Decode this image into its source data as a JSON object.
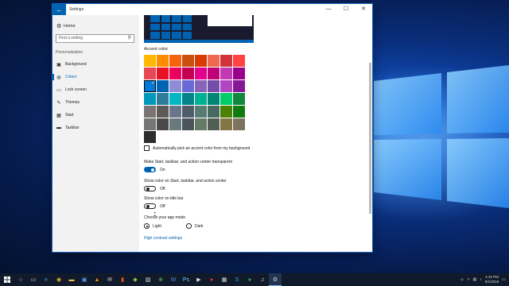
{
  "window": {
    "title": "Settings"
  },
  "sidebar": {
    "home_label": "Home",
    "search_placeholder": "Find a setting",
    "section": "Personalization",
    "items": [
      {
        "label": "Background",
        "icon": "picture-icon"
      },
      {
        "label": "Colors",
        "icon": "palette-icon",
        "active": true
      },
      {
        "label": "Lock screen",
        "icon": "lock-screen-icon"
      },
      {
        "label": "Themes",
        "icon": "brush-icon"
      },
      {
        "label": "Start",
        "icon": "start-icon"
      },
      {
        "label": "Taskbar",
        "icon": "taskbar-icon"
      }
    ]
  },
  "main": {
    "accent_heading": "Accent color",
    "swatch_colors": [
      "#ffb900",
      "#ff8c00",
      "#f7630c",
      "#ca5010",
      "#da3b01",
      "#ef6950",
      "#d13438",
      "#ff4343",
      "#e74856",
      "#e81123",
      "#ea005e",
      "#c30052",
      "#e3008c",
      "#bf0077",
      "#c239b3",
      "#9a0089",
      "#0078d7",
      "#0063b1",
      "#8e8cd8",
      "#6b69d6",
      "#8764b8",
      "#744da9",
      "#b146c2",
      "#881798",
      "#0099bc",
      "#2d7d9a",
      "#00b7c3",
      "#038387",
      "#00b294",
      "#018574",
      "#00cc6a",
      "#10893e",
      "#7a7574",
      "#5d5a58",
      "#68768a",
      "#515c6b",
      "#567c73",
      "#486860",
      "#498205",
      "#107c10",
      "#767676",
      "#4c4a48",
      "#69797e",
      "#4a5459",
      "#647c64",
      "#525e54",
      "#847545",
      "#7e735f",
      "#2d2d2d"
    ],
    "selected_swatch": "#0078d7",
    "auto_pick_label": "Automatically pick an accent color from my background",
    "transparent_label": "Make Start, taskbar, and action center transparent",
    "transparent_state": "On",
    "show_color_start_label": "Show color on Start, taskbar, and action center",
    "show_color_start_state": "Off",
    "show_color_title_label": "Show color on title bar",
    "show_color_title_state": "Off",
    "app_mode_label": "Choose your app mode",
    "light_label": "Light",
    "dark_label": "Dark",
    "app_mode_selected": "Light",
    "high_contrast_link": "High contrast settings"
  },
  "taskbar": {
    "time": "4:15 PM",
    "date": "8/1/2016",
    "icons": [
      "cortana-icon",
      "task-view-icon",
      "edge-icon",
      "chrome-icon",
      "file-explorer-icon",
      "store-icon",
      "vlc-icon",
      "mail-icon",
      "office-icon",
      "game-icon",
      "photos-icon",
      "xbox-icon",
      "word-icon",
      "photoshop-icon",
      "media-icon",
      "record-icon",
      "calculator-icon",
      "skype-icon",
      "spotify-icon",
      "music-icon",
      "settings-icon"
    ]
  }
}
